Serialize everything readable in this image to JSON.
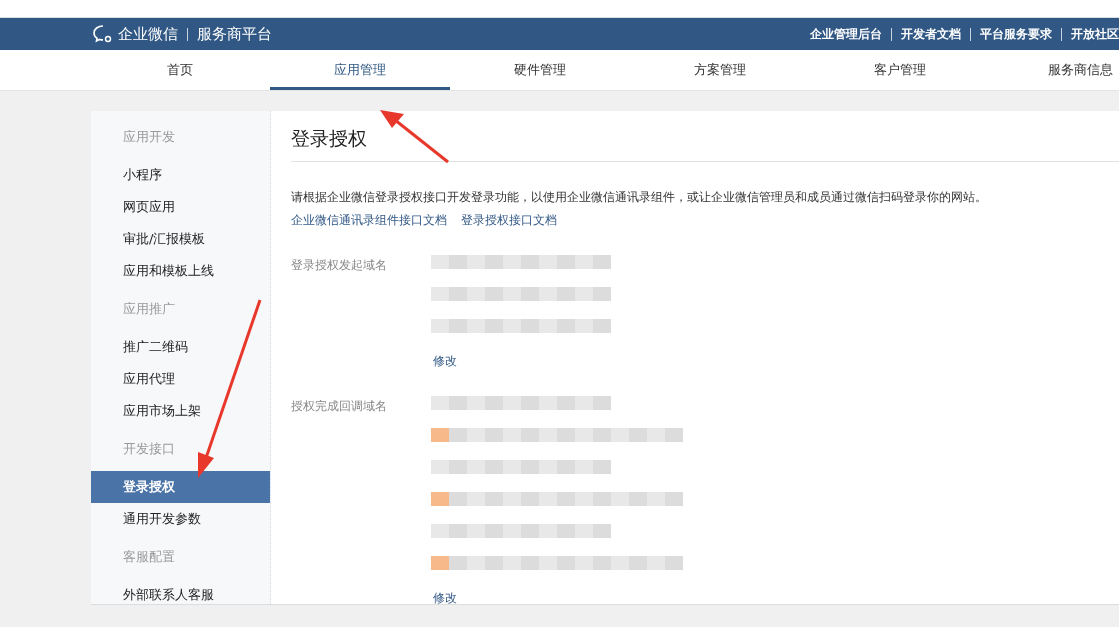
{
  "header": {
    "brand": "企业微信",
    "platform": "服务商平台",
    "links": [
      "企业管理后台",
      "开发者文档",
      "平台服务要求",
      "开放社区"
    ]
  },
  "nav": [
    {
      "label": "首页",
      "selected": false
    },
    {
      "label": "应用管理",
      "selected": true
    },
    {
      "label": "硬件管理",
      "selected": false
    },
    {
      "label": "方案管理",
      "selected": false
    },
    {
      "label": "客户管理",
      "selected": false
    },
    {
      "label": "服务商信息",
      "selected": false
    }
  ],
  "sidebar": [
    {
      "title": "应用开发",
      "items": [
        {
          "label": "小程序",
          "selected": false
        },
        {
          "label": "网页应用",
          "selected": false
        },
        {
          "label": "审批/汇报模板",
          "selected": false
        },
        {
          "label": "应用和模板上线",
          "selected": false
        }
      ]
    },
    {
      "title": "应用推广",
      "items": [
        {
          "label": "推广二维码",
          "selected": false
        },
        {
          "label": "应用代理",
          "selected": false
        },
        {
          "label": "应用市场上架",
          "selected": false
        }
      ]
    },
    {
      "title": "开发接口",
      "items": [
        {
          "label": "登录授权",
          "selected": true
        },
        {
          "label": "通用开发参数",
          "selected": false
        }
      ]
    },
    {
      "title": "客服配置",
      "items": [
        {
          "label": "外部联系人客服",
          "selected": false
        }
      ]
    }
  ],
  "page": {
    "title": "登录授权",
    "description": "请根据企业微信登录授权接口开发登录功能，以使用企业微信通讯录组件，或让企业微信管理员和成员通过微信扫码登录你的网站。",
    "doc_links": [
      "企业微信通讯录组件接口文档",
      "登录授权接口文档"
    ],
    "fields": [
      {
        "label": "登录授权发起域名",
        "edit": "修改"
      },
      {
        "label": "授权完成回调域名",
        "edit": "修改"
      }
    ]
  }
}
